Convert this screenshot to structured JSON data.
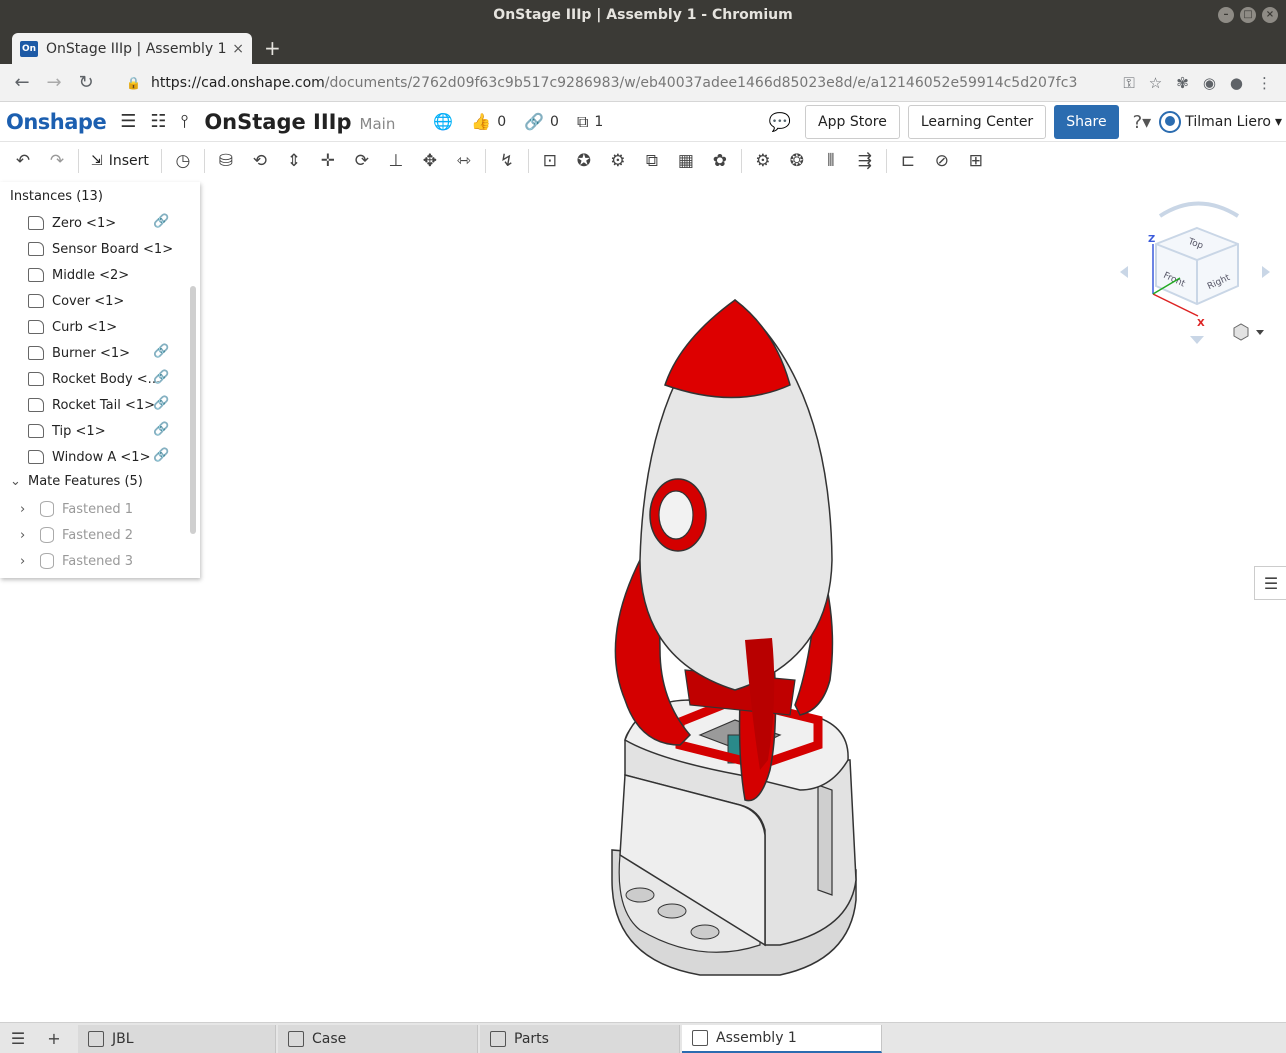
{
  "window": {
    "title": "OnStage IIIp | Assembly 1 - Chromium"
  },
  "browser": {
    "tab_title": "OnStage IIIp | Assembly 1",
    "tab_favicon": "On",
    "tab_close": "×",
    "new_tab": "+",
    "url_host": "https://cad.onshape.com",
    "url_path": "/documents/2762d09f63c9b517c9286983/w/eb40037adee1466d85023e8d/e/a12146052e59914c5d207fc3"
  },
  "header": {
    "logo": "Onshape",
    "doc_name": "OnStage IIIp",
    "branch": "Main",
    "likes": "0",
    "links": "0",
    "copies": "1",
    "app_store": "App Store",
    "learning_center": "Learning Center",
    "share": "Share",
    "user": "Tilman Liero"
  },
  "toolbar": {
    "insert": "Insert"
  },
  "instances": {
    "title": "Instances (13)",
    "items": [
      {
        "label": "Zero <1>",
        "linked": true
      },
      {
        "label": "Sensor Board <1>",
        "linked": false
      },
      {
        "label": "Middle <2>",
        "linked": false
      },
      {
        "label": "Cover <1>",
        "linked": false
      },
      {
        "label": "Curb <1>",
        "linked": false
      },
      {
        "label": "Burner <1>",
        "linked": true
      },
      {
        "label": "Rocket Body <...",
        "linked": true
      },
      {
        "label": "Rocket Tail <1>",
        "linked": true
      },
      {
        "label": "Tip <1>",
        "linked": true
      },
      {
        "label": "Window A <1>",
        "linked": true
      }
    ]
  },
  "mates": {
    "title": "Mate Features (5)",
    "items": [
      "Fastened 1",
      "Fastened 2",
      "Fastened 3"
    ]
  },
  "viewcube": {
    "top": "Top",
    "front": "Front",
    "right": "Right",
    "z": "Z",
    "x": "X"
  },
  "bottom_tabs": [
    "JBL",
    "Case",
    "Parts",
    "Assembly 1"
  ],
  "colors": {
    "accent": "#2b6cb0",
    "rocket_red": "#d40000",
    "rocket_white": "#e6e6e6"
  }
}
